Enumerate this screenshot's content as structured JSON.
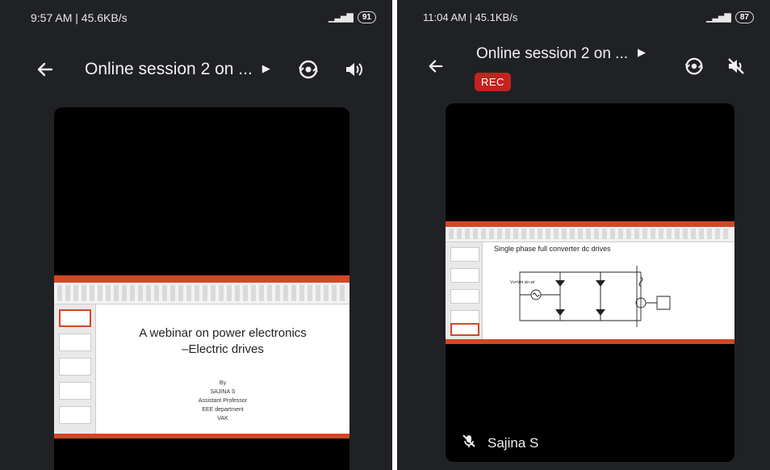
{
  "left": {
    "status": {
      "time": "9:57 AM | 45.6KB/s",
      "battery": "91"
    },
    "title": "Online session 2 on ...",
    "slide": {
      "title_line1": "A webinar on power electronics",
      "title_line2": "–Electric drives",
      "credits": [
        "By",
        "SAJINA S",
        "Assistant Professor",
        "EEE department",
        "VAK"
      ]
    },
    "icons": {
      "back": "back-arrow-icon",
      "switch_camera": "switch-camera-icon",
      "speaker": "speaker-icon"
    }
  },
  "right": {
    "status": {
      "time": "11:04 AM | 45.1KB/s",
      "battery": "87"
    },
    "title": "Online session 2 on ...",
    "rec_label": "REC",
    "slide": {
      "title": "Single phase full converter dc drives",
      "circuit_label": "Vs=Vm sin wt"
    },
    "participant_name": "Sajina S",
    "icons": {
      "back": "back-arrow-icon",
      "switch_camera": "switch-camera-icon",
      "speaker_muted": "speaker-muted-icon",
      "mic_muted": "mic-muted-icon"
    }
  },
  "colors": {
    "background": "#202124",
    "rec": "#c5221f",
    "ppt_accent": "#d24726"
  }
}
